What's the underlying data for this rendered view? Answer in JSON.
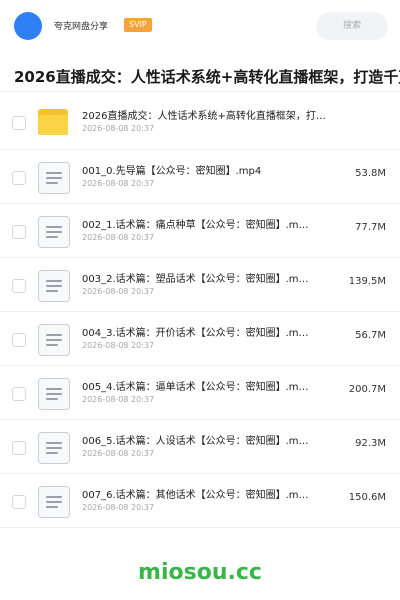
{
  "header": {
    "share_name": "夸克网盘分享",
    "badge": "SVIP",
    "search_label": "搜索"
  },
  "title": "2026直播成交：人性话术系统+高转化直播框架，打造千万",
  "files": [
    {
      "type": "folder",
      "name": "2026直播成交：人性话术系统+高转化直播框架，打…",
      "date": "2026-08-08 20:37",
      "size": ""
    },
    {
      "type": "file",
      "name": "001_0.先导篇【公众号：密知圈】.mp4",
      "date": "2026-08-08 20:37",
      "size": "53.8M"
    },
    {
      "type": "file",
      "name": "002_1.话术篇：痛点种草【公众号：密知圈】.m…",
      "date": "2026-08-08 20:37",
      "size": "77.7M"
    },
    {
      "type": "file",
      "name": "003_2.话术篇：塑品话术【公众号：密知圈】.m…",
      "date": "2026-08-08 20:37",
      "size": "139.5M"
    },
    {
      "type": "file",
      "name": "004_3.话术篇：开价话术【公众号：密知圈】.m…",
      "date": "2026-08-08 20:37",
      "size": "56.7M"
    },
    {
      "type": "file",
      "name": "005_4.话术篇：逼单话术【公众号：密知圈】.m…",
      "date": "2026-08-08 20:37",
      "size": "200.7M"
    },
    {
      "type": "file",
      "name": "006_5.话术篇：人设话术【公众号：密知圈】.m…",
      "date": "2026-08-08 20:37",
      "size": "92.3M"
    },
    {
      "type": "file",
      "name": "007_6.话术篇：其他话术【公众号：密知圈】.m…",
      "date": "2026-08-08 20:37",
      "size": "150.6M"
    }
  ],
  "watermark": "miosou.cc",
  "colors": {
    "avatar": "#2f80f5",
    "badge": "#f7a23b",
    "folder": "#f8c22e",
    "watermark": "#3bb54a"
  }
}
